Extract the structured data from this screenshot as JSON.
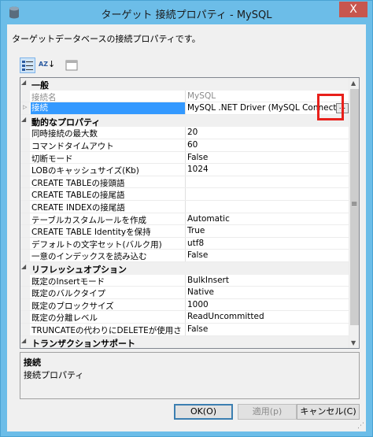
{
  "window": {
    "title": "ターゲット 接続プロパティ - MySQL",
    "close_glyph": "X"
  },
  "description": "ターゲットデータベースの接続プロパティです。",
  "toolbar": {
    "categorized_icon": "categorized-view-icon",
    "alphabetical_icon": "alphabetical-sort-icon",
    "pages_icon": "property-pages-icon",
    "alpha_label": "AZ"
  },
  "grid": {
    "rows": [
      {
        "kind": "category",
        "label": "一般"
      },
      {
        "kind": "prop",
        "name": "接続名",
        "value": "MySQL",
        "dim": true
      },
      {
        "kind": "prop",
        "name": "接続",
        "value": "MySQL .NET Driver (MySQL Connector/",
        "selected": true,
        "expandable": true,
        "ellipsis": "..."
      },
      {
        "kind": "category",
        "label": "動的なプロパティ"
      },
      {
        "kind": "prop",
        "name": "同時接続の最大数",
        "value": "20"
      },
      {
        "kind": "prop",
        "name": "コマンドタイムアウト",
        "value": "60"
      },
      {
        "kind": "prop",
        "name": "切断モード",
        "value": "False"
      },
      {
        "kind": "prop",
        "name": "LOBのキャッシュサイズ(Kb)",
        "value": "1024"
      },
      {
        "kind": "prop",
        "name": "CREATE TABLEの接頭語",
        "value": ""
      },
      {
        "kind": "prop",
        "name": "CREATE TABLEの接尾語",
        "value": ""
      },
      {
        "kind": "prop",
        "name": "CREATE INDEXの接尾語",
        "value": ""
      },
      {
        "kind": "prop",
        "name": "テーブルカスタムルールを作成",
        "value": "Automatic"
      },
      {
        "kind": "prop",
        "name": "CREATE TABLE Identityを保持",
        "value": "True"
      },
      {
        "kind": "prop",
        "name": "デフォルトの文字セット(バルク用)",
        "value": "utf8"
      },
      {
        "kind": "prop",
        "name": "一意のインデックスを読み込む",
        "value": "False"
      },
      {
        "kind": "category",
        "label": "リフレッシュオプション"
      },
      {
        "kind": "prop",
        "name": "既定のInsertモード",
        "value": "BulkInsert"
      },
      {
        "kind": "prop",
        "name": "既定のバルクタイプ",
        "value": "Native"
      },
      {
        "kind": "prop",
        "name": "既定のブロックサイズ",
        "value": "1000"
      },
      {
        "kind": "prop",
        "name": "既定の分離レベル",
        "value": "ReadUncommitted"
      },
      {
        "kind": "prop",
        "name": "TRUNCATEの代わりにDELETEが使用さ",
        "value": "False"
      },
      {
        "kind": "category",
        "label": "トランザクションサポート"
      }
    ]
  },
  "help": {
    "title": "接続",
    "text": "接続プロパティ"
  },
  "buttons": {
    "ok": "OK(O)",
    "apply": "適用(p)",
    "cancel": "キャンセル(C)"
  },
  "colors": {
    "titlebar": "#6cbde8",
    "close": "#c7564e",
    "selection": "#3399ff",
    "highlight_box": "#e8201b"
  }
}
